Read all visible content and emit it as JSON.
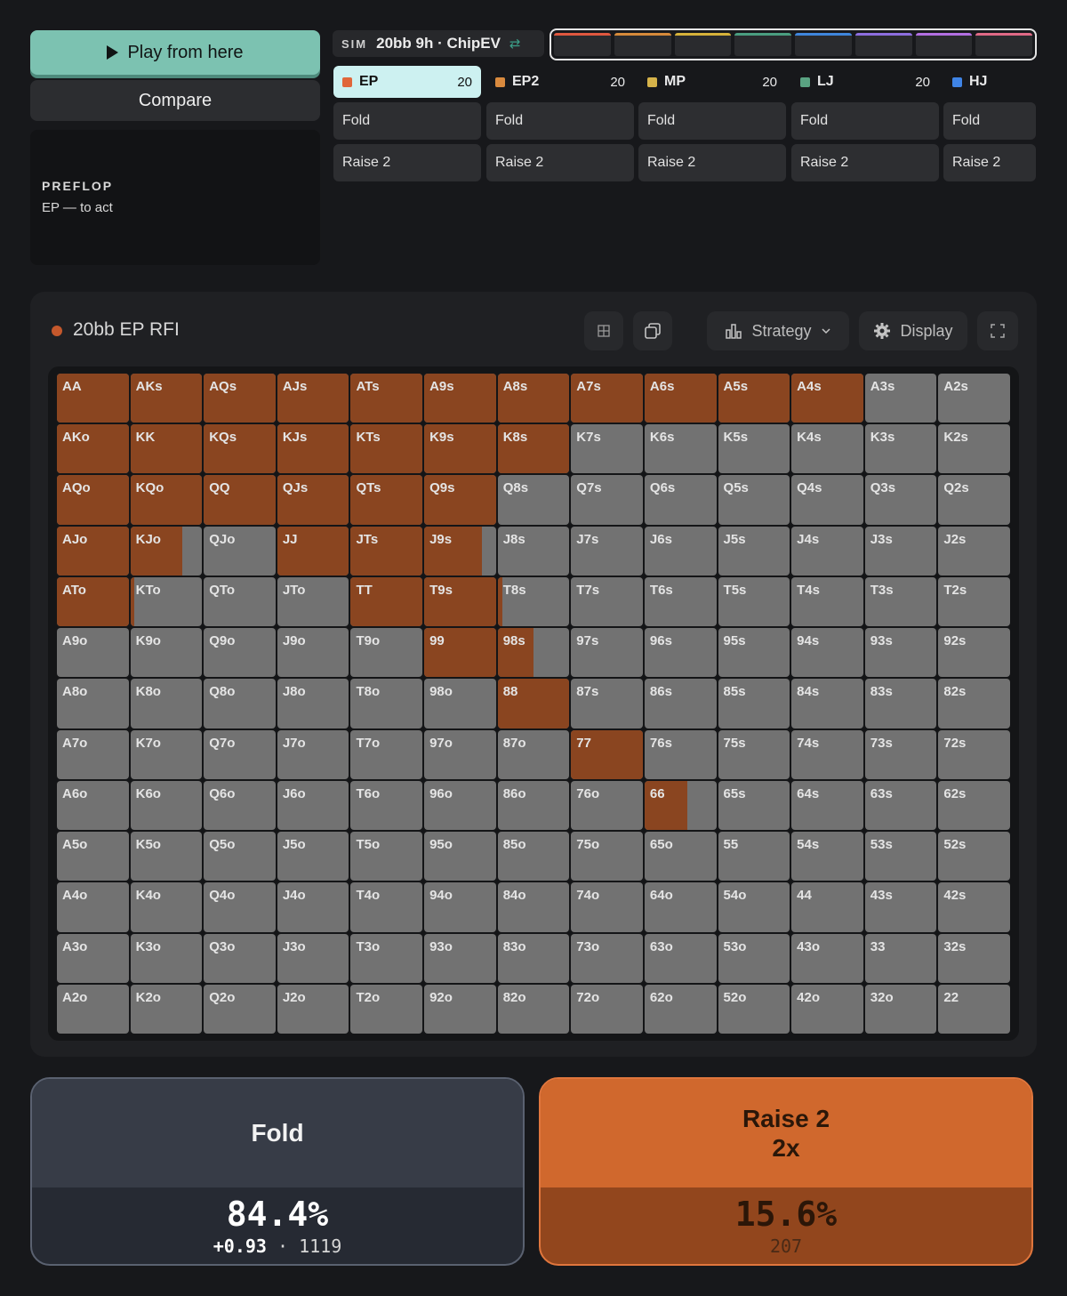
{
  "left": {
    "play_label": "Play from here",
    "compare_label": "Compare",
    "street": "PREFLOP",
    "to_act": "EP — to act"
  },
  "sim": {
    "tag": "SIM",
    "name": "20bb 9h · ChipEV",
    "swap_icon": "⇄"
  },
  "colorbar": [
    "#e0583f",
    "#d68a3a",
    "#d6b23a",
    "#4a9e80",
    "#3f86dd",
    "#8d6ee0",
    "#b26fe2",
    "#e06a86"
  ],
  "positions": [
    {
      "name": "EP",
      "stack": "20",
      "color": "#e0663a",
      "actions": [
        "Fold",
        "Raise 2"
      ]
    },
    {
      "name": "EP2",
      "stack": "20",
      "color": "#d98a3e",
      "actions": [
        "Fold",
        "Raise 2"
      ]
    },
    {
      "name": "MP",
      "stack": "20",
      "color": "#d6b34a",
      "actions": [
        "Fold",
        "Raise 2"
      ]
    },
    {
      "name": "LJ",
      "stack": "20",
      "color": "#5aa382",
      "actions": [
        "Fold",
        "Raise 2"
      ]
    },
    {
      "name": "HJ",
      "stack": "",
      "color": "#3f84e6",
      "actions": [
        "Fold",
        "Raise 2"
      ]
    }
  ],
  "range": {
    "title": "20bb EP RFI",
    "strategy_label": "Strategy",
    "display_label": "Display"
  },
  "matrix": {
    "rows": [
      [
        [
          "AA",
          1
        ],
        [
          "AKs",
          1
        ],
        [
          "AQs",
          1
        ],
        [
          "AJs",
          1
        ],
        [
          "ATs",
          1
        ],
        [
          "A9s",
          1
        ],
        [
          "A8s",
          1
        ],
        [
          "A7s",
          1
        ],
        [
          "A6s",
          1
        ],
        [
          "A5s",
          1
        ],
        [
          "A4s",
          1
        ],
        [
          "A3s",
          0
        ],
        [
          "A2s",
          0
        ]
      ],
      [
        [
          "AKo",
          1
        ],
        [
          "KK",
          1
        ],
        [
          "KQs",
          1
        ],
        [
          "KJs",
          1
        ],
        [
          "KTs",
          1
        ],
        [
          "K9s",
          1
        ],
        [
          "K8s",
          1
        ],
        [
          "K7s",
          0
        ],
        [
          "K6s",
          0
        ],
        [
          "K5s",
          0
        ],
        [
          "K4s",
          0
        ],
        [
          "K3s",
          0
        ],
        [
          "K2s",
          0
        ]
      ],
      [
        [
          "AQo",
          1
        ],
        [
          "KQo",
          1
        ],
        [
          "QQ",
          1
        ],
        [
          "QJs",
          1
        ],
        [
          "QTs",
          1
        ],
        [
          "Q9s",
          1
        ],
        [
          "Q8s",
          0
        ],
        [
          "Q7s",
          0
        ],
        [
          "Q6s",
          0
        ],
        [
          "Q5s",
          0
        ],
        [
          "Q4s",
          0
        ],
        [
          "Q3s",
          0
        ],
        [
          "Q2s",
          0
        ]
      ],
      [
        [
          "AJo",
          1
        ],
        [
          "KJo",
          0.72
        ],
        [
          "QJo",
          0
        ],
        [
          "JJ",
          1
        ],
        [
          "JTs",
          1
        ],
        [
          "J9s",
          0.8
        ],
        [
          "J8s",
          0
        ],
        [
          "J7s",
          0
        ],
        [
          "J6s",
          0
        ],
        [
          "J5s",
          0
        ],
        [
          "J4s",
          0
        ],
        [
          "J3s",
          0
        ],
        [
          "J2s",
          0
        ]
      ],
      [
        [
          "ATo",
          1
        ],
        [
          "KTo",
          0.06
        ],
        [
          "QTo",
          0
        ],
        [
          "JTo",
          0
        ],
        [
          "TT",
          1
        ],
        [
          "T9s",
          1
        ],
        [
          "T8s",
          0.06
        ],
        [
          "T7s",
          0
        ],
        [
          "T6s",
          0
        ],
        [
          "T5s",
          0
        ],
        [
          "T4s",
          0
        ],
        [
          "T3s",
          0
        ],
        [
          "T2s",
          0
        ]
      ],
      [
        [
          "A9o",
          0
        ],
        [
          "K9o",
          0
        ],
        [
          "Q9o",
          0
        ],
        [
          "J9o",
          0
        ],
        [
          "T9o",
          0
        ],
        [
          "99",
          1
        ],
        [
          "98s",
          0.5
        ],
        [
          "97s",
          0
        ],
        [
          "96s",
          0
        ],
        [
          "95s",
          0
        ],
        [
          "94s",
          0
        ],
        [
          "93s",
          0
        ],
        [
          "92s",
          0
        ]
      ],
      [
        [
          "A8o",
          0
        ],
        [
          "K8o",
          0
        ],
        [
          "Q8o",
          0
        ],
        [
          "J8o",
          0
        ],
        [
          "T8o",
          0
        ],
        [
          "98o",
          0
        ],
        [
          "88",
          1
        ],
        [
          "87s",
          0
        ],
        [
          "86s",
          0
        ],
        [
          "85s",
          0
        ],
        [
          "84s",
          0
        ],
        [
          "83s",
          0
        ],
        [
          "82s",
          0
        ]
      ],
      [
        [
          "A7o",
          0
        ],
        [
          "K7o",
          0
        ],
        [
          "Q7o",
          0
        ],
        [
          "J7o",
          0
        ],
        [
          "T7o",
          0
        ],
        [
          "97o",
          0
        ],
        [
          "87o",
          0
        ],
        [
          "77",
          1
        ],
        [
          "76s",
          0
        ],
        [
          "75s",
          0
        ],
        [
          "74s",
          0
        ],
        [
          "73s",
          0
        ],
        [
          "72s",
          0
        ]
      ],
      [
        [
          "A6o",
          0
        ],
        [
          "K6o",
          0
        ],
        [
          "Q6o",
          0
        ],
        [
          "J6o",
          0
        ],
        [
          "T6o",
          0
        ],
        [
          "96o",
          0
        ],
        [
          "86o",
          0
        ],
        [
          "76o",
          0
        ],
        [
          "66",
          0.6
        ],
        [
          "65s",
          0
        ],
        [
          "64s",
          0
        ],
        [
          "63s",
          0
        ],
        [
          "62s",
          0
        ]
      ],
      [
        [
          "A5o",
          0
        ],
        [
          "K5o",
          0
        ],
        [
          "Q5o",
          0
        ],
        [
          "J5o",
          0
        ],
        [
          "T5o",
          0
        ],
        [
          "95o",
          0
        ],
        [
          "85o",
          0
        ],
        [
          "75o",
          0
        ],
        [
          "65o",
          0
        ],
        [
          "55",
          0
        ],
        [
          "54s",
          0
        ],
        [
          "53s",
          0
        ],
        [
          "52s",
          0
        ]
      ],
      [
        [
          "A4o",
          0
        ],
        [
          "K4o",
          0
        ],
        [
          "Q4o",
          0
        ],
        [
          "J4o",
          0
        ],
        [
          "T4o",
          0
        ],
        [
          "94o",
          0
        ],
        [
          "84o",
          0
        ],
        [
          "74o",
          0
        ],
        [
          "64o",
          0
        ],
        [
          "54o",
          0
        ],
        [
          "44",
          0
        ],
        [
          "43s",
          0
        ],
        [
          "42s",
          0
        ]
      ],
      [
        [
          "A3o",
          0
        ],
        [
          "K3o",
          0
        ],
        [
          "Q3o",
          0
        ],
        [
          "J3o",
          0
        ],
        [
          "T3o",
          0
        ],
        [
          "93o",
          0
        ],
        [
          "83o",
          0
        ],
        [
          "73o",
          0
        ],
        [
          "63o",
          0
        ],
        [
          "53o",
          0
        ],
        [
          "43o",
          0
        ],
        [
          "33",
          0
        ],
        [
          "32s",
          0
        ]
      ],
      [
        [
          "A2o",
          0
        ],
        [
          "K2o",
          0
        ],
        [
          "Q2o",
          0
        ],
        [
          "J2o",
          0
        ],
        [
          "T2o",
          0
        ],
        [
          "92o",
          0
        ],
        [
          "82o",
          0
        ],
        [
          "72o",
          0
        ],
        [
          "62o",
          0
        ],
        [
          "52o",
          0
        ],
        [
          "42o",
          0
        ],
        [
          "32o",
          0
        ],
        [
          "22",
          0
        ]
      ]
    ]
  },
  "summary": {
    "fold": {
      "label": "Fold",
      "pct": "84.4%",
      "ev": "+0.93",
      "sep": "·",
      "combos": "1119"
    },
    "raise": {
      "label": "Raise 2",
      "size": "2x",
      "pct": "15.6%",
      "combos": "207"
    }
  }
}
